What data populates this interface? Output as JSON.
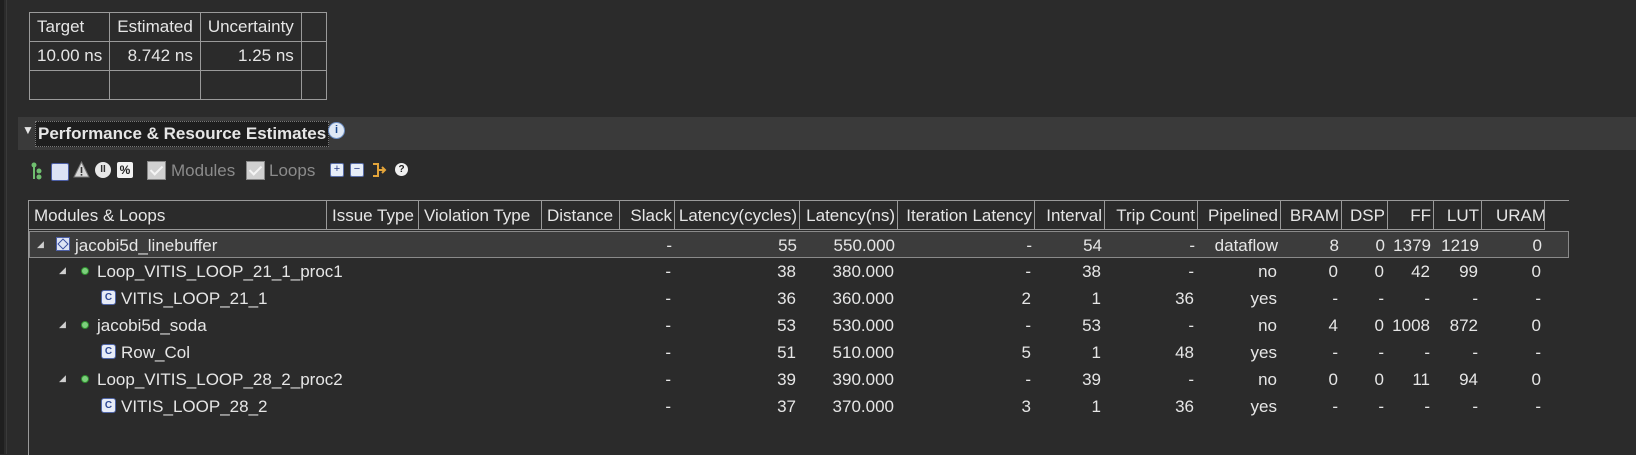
{
  "timing": {
    "headers": [
      "Target",
      "Estimated",
      "Uncertainty"
    ],
    "values": [
      "10.00 ns",
      "8.742 ns",
      "1.25 ns"
    ]
  },
  "section": {
    "title": "Performance & Resource Estimates"
  },
  "toolbar": {
    "modules_label": "Modules",
    "loops_label": "Loops"
  },
  "grid": {
    "columns": [
      "Modules & Loops",
      "Issue Type",
      "Violation Type",
      "Distance",
      "Slack",
      "Latency(cycles)",
      "Latency(ns)",
      "Iteration Latency",
      "Interval",
      "Trip Count",
      "Pipelined",
      "BRAM",
      "DSP",
      "FF",
      "LUT",
      "URAM"
    ],
    "rows": [
      {
        "name": "jacobi5d_linebuffer",
        "slack": "-",
        "lat_cycles": "55",
        "lat_ns": "550.000",
        "iter_lat": "-",
        "interval": "54",
        "trip": "-",
        "pipelined": "dataflow",
        "bram": "8",
        "dsp": "0",
        "ff": "1379",
        "lut": "1219",
        "uram": "0"
      },
      {
        "name": "Loop_VITIS_LOOP_21_1_proc1",
        "slack": "-",
        "lat_cycles": "38",
        "lat_ns": "380.000",
        "iter_lat": "-",
        "interval": "38",
        "trip": "-",
        "pipelined": "no",
        "bram": "0",
        "dsp": "0",
        "ff": "42",
        "lut": "99",
        "uram": "0"
      },
      {
        "name": "VITIS_LOOP_21_1",
        "slack": "-",
        "lat_cycles": "36",
        "lat_ns": "360.000",
        "iter_lat": "2",
        "interval": "1",
        "trip": "36",
        "pipelined": "yes",
        "bram": "-",
        "dsp": "-",
        "ff": "-",
        "lut": "-",
        "uram": "-"
      },
      {
        "name": "jacobi5d_soda",
        "slack": "-",
        "lat_cycles": "53",
        "lat_ns": "530.000",
        "iter_lat": "-",
        "interval": "53",
        "trip": "-",
        "pipelined": "no",
        "bram": "4",
        "dsp": "0",
        "ff": "1008",
        "lut": "872",
        "uram": "0"
      },
      {
        "name": "Row_Col",
        "slack": "-",
        "lat_cycles": "51",
        "lat_ns": "510.000",
        "iter_lat": "5",
        "interval": "1",
        "trip": "48",
        "pipelined": "yes",
        "bram": "-",
        "dsp": "-",
        "ff": "-",
        "lut": "-",
        "uram": "-"
      },
      {
        "name": "Loop_VITIS_LOOP_28_2_proc2",
        "slack": "-",
        "lat_cycles": "39",
        "lat_ns": "390.000",
        "iter_lat": "-",
        "interval": "39",
        "trip": "-",
        "pipelined": "no",
        "bram": "0",
        "dsp": "0",
        "ff": "11",
        "lut": "94",
        "uram": "0"
      },
      {
        "name": "VITIS_LOOP_28_2",
        "slack": "-",
        "lat_cycles": "37",
        "lat_ns": "370.000",
        "iter_lat": "3",
        "interval": "1",
        "trip": "36",
        "pipelined": "yes",
        "bram": "-",
        "dsp": "-",
        "ff": "-",
        "lut": "-",
        "uram": "-"
      }
    ]
  }
}
